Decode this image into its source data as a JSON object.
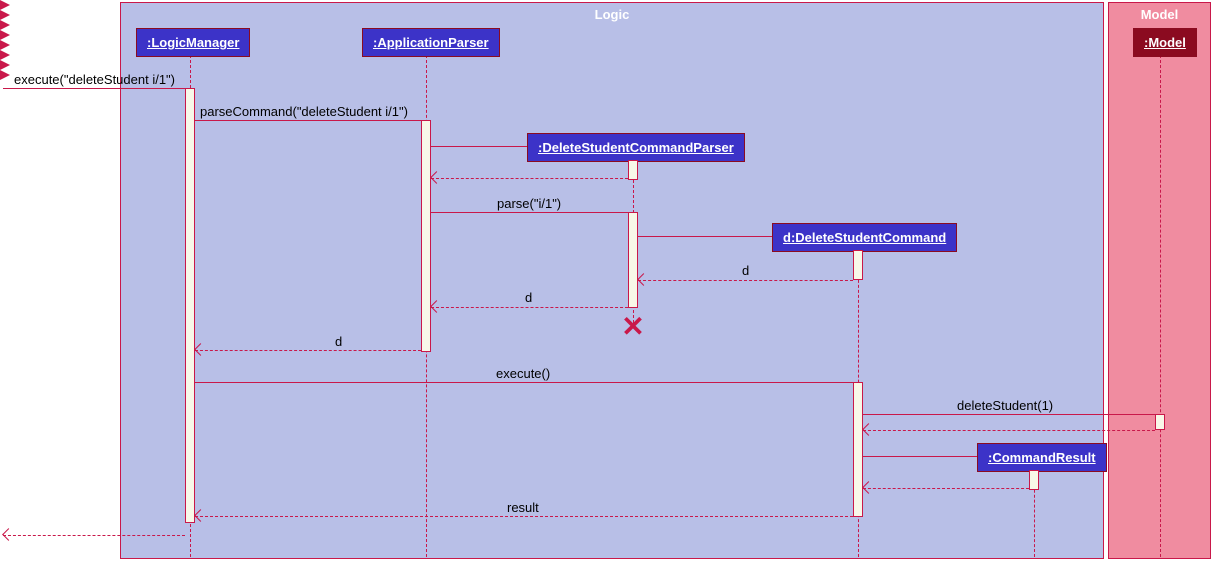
{
  "diagram_type": "UML Sequence Diagram",
  "fragments": {
    "logic": {
      "title": "Logic"
    },
    "model": {
      "title": "Model"
    }
  },
  "participants": {
    "logicManager": ":LogicManager",
    "applicationParser": ":ApplicationParser",
    "deleteParser": ":DeleteStudentCommandParser",
    "deleteCommand": "d:DeleteStudentCommand",
    "commandResult": ":CommandResult",
    "model": ":Model"
  },
  "messages": {
    "execute_in": "execute(\"deleteStudent i/1\")",
    "parseCommand": "parseCommand(\"deleteStudent i/1\")",
    "parse": "parse(\"i/1\")",
    "return_d1": "d",
    "return_d2": "d",
    "return_d3": "d",
    "execute": "execute()",
    "deleteStudent": "deleteStudent(1)",
    "result": "result"
  },
  "chart_data": {
    "type": "sequence_diagram",
    "fragments": [
      "Logic",
      "Model"
    ],
    "participants": [
      {
        "name": ":LogicManager",
        "fragment": "Logic"
      },
      {
        "name": ":ApplicationParser",
        "fragment": "Logic"
      },
      {
        "name": ":DeleteStudentCommandParser",
        "fragment": "Logic",
        "created": true,
        "destroyed": true
      },
      {
        "name": "d:DeleteStudentCommand",
        "fragment": "Logic",
        "created": true
      },
      {
        "name": ":CommandResult",
        "fragment": "Logic",
        "created": true
      },
      {
        "name": ":Model",
        "fragment": "Model"
      }
    ],
    "interactions": [
      {
        "from": "external",
        "to": ":LogicManager",
        "label": "execute(\"deleteStudent i/1\")",
        "type": "call"
      },
      {
        "from": ":LogicManager",
        "to": ":ApplicationParser",
        "label": "parseCommand(\"deleteStudent i/1\")",
        "type": "call"
      },
      {
        "from": ":ApplicationParser",
        "to": ":DeleteStudentCommandParser",
        "label": "",
        "type": "create"
      },
      {
        "from": ":DeleteStudentCommandParser",
        "to": ":ApplicationParser",
        "label": "",
        "type": "return"
      },
      {
        "from": ":ApplicationParser",
        "to": ":DeleteStudentCommandParser",
        "label": "parse(\"i/1\")",
        "type": "call"
      },
      {
        "from": ":DeleteStudentCommandParser",
        "to": "d:DeleteStudentCommand",
        "label": "",
        "type": "create"
      },
      {
        "from": "d:DeleteStudentCommand",
        "to": ":DeleteStudentCommandParser",
        "label": "d",
        "type": "return"
      },
      {
        "from": ":DeleteStudentCommandParser",
        "to": ":ApplicationParser",
        "label": "d",
        "type": "return"
      },
      {
        "from": ":DeleteStudentCommandParser",
        "to": null,
        "label": "",
        "type": "destroy"
      },
      {
        "from": ":ApplicationParser",
        "to": ":LogicManager",
        "label": "d",
        "type": "return"
      },
      {
        "from": ":LogicManager",
        "to": "d:DeleteStudentCommand",
        "label": "execute()",
        "type": "call"
      },
      {
        "from": "d:DeleteStudentCommand",
        "to": ":Model",
        "label": "deleteStudent(1)",
        "type": "call"
      },
      {
        "from": ":Model",
        "to": "d:DeleteStudentCommand",
        "label": "",
        "type": "return"
      },
      {
        "from": "d:DeleteStudentCommand",
        "to": ":CommandResult",
        "label": "",
        "type": "create"
      },
      {
        "from": ":CommandResult",
        "to": "d:DeleteStudentCommand",
        "label": "",
        "type": "return"
      },
      {
        "from": "d:DeleteStudentCommand",
        "to": ":LogicManager",
        "label": "result",
        "type": "return"
      },
      {
        "from": ":LogicManager",
        "to": "external",
        "label": "",
        "type": "return"
      }
    ]
  }
}
